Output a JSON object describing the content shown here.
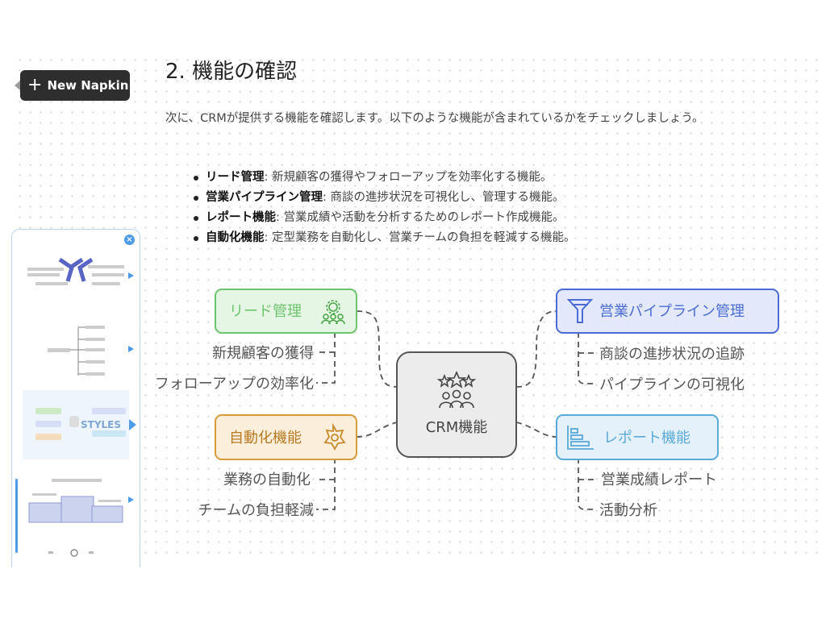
{
  "toolbar": {
    "new_napkin_label": "New Napkin"
  },
  "document": {
    "title": "2. 機能の確認",
    "intro": "次に、CRMが提供する機能を確認します。以下のような機能が含まれているかをチェックしましょう。",
    "bullets": [
      {
        "term": "リード管理",
        "desc": ": 新規顧客の獲得やフォローアップを効率化する機能。"
      },
      {
        "term": "営業パイプライン管理",
        "desc": ": 商談の進捗状況を可視化し、管理する機能。"
      },
      {
        "term": "レポート機能",
        "desc": ": 営業成績や活動を分析するためのレポート作成機能。"
      },
      {
        "term": "自動化機能",
        "desc": ": 定型業務を自動化し、営業チームの負担を軽減する機能。"
      }
    ]
  },
  "styles_panel": {
    "label": "STYLES"
  },
  "diagram": {
    "center": "CRM機能",
    "branches": [
      {
        "title": "リード管理",
        "color": "#6cc46c",
        "icon": "people-gear-icon",
        "leaves": [
          "新規顧客の獲得",
          "フォローアップの効率化"
        ]
      },
      {
        "title": "営業パイプライン管理",
        "color": "#4a6cd4",
        "icon": "funnel-icon",
        "leaves": [
          "商談の進捗状況の追跡",
          "パイプラインの可視化"
        ]
      },
      {
        "title": "自動化機能",
        "color": "#d99a3c",
        "icon": "gear-icon",
        "leaves": [
          "業務の自動化",
          "チームの負担軽減"
        ]
      },
      {
        "title": "レポート機能",
        "color": "#5aa9d9",
        "icon": "bar-chart-icon",
        "leaves": [
          "営業成績レポート",
          "活動分析"
        ]
      }
    ]
  }
}
